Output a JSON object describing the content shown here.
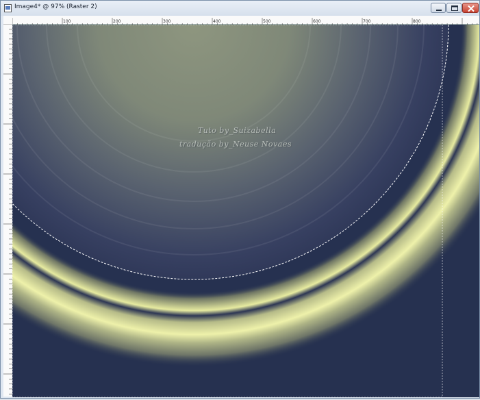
{
  "window": {
    "title": "Image4* @  97% (Raster 2)"
  },
  "controls": {
    "minimize": "minimize-icon",
    "maximize": "maximize-icon",
    "close": "close-icon"
  },
  "ruler": {
    "labels": [
      "100",
      "200",
      "300",
      "400",
      "500",
      "600",
      "700",
      "800"
    ]
  },
  "canvas": {
    "watermark_line1": "Tuto by_Suizabella",
    "watermark_line2": "tradução by_Neuse Novaes"
  },
  "colors": {
    "background": "#263150",
    "sphere_light": "#8c947c",
    "ring_highlight": "#e8eca0",
    "selection": "#ffffff"
  }
}
